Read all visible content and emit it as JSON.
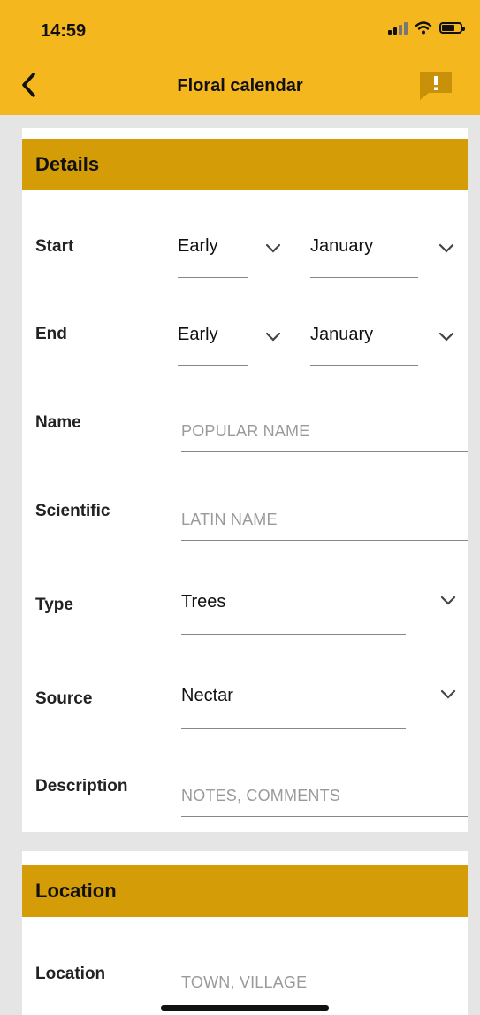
{
  "status": {
    "time": "14:59"
  },
  "header": {
    "title": "Floral calendar"
  },
  "details": {
    "section_title": "Details",
    "start": {
      "label": "Start",
      "period": "Early",
      "month": "January"
    },
    "end": {
      "label": "End",
      "period": "Early",
      "month": "January"
    },
    "name": {
      "label": "Name",
      "placeholder": "POPULAR NAME"
    },
    "scientific": {
      "label": "Scientific",
      "placeholder": "LATIN NAME"
    },
    "type": {
      "label": "Type",
      "value": "Trees"
    },
    "source": {
      "label": "Source",
      "value": "Nectar"
    },
    "description": {
      "label": "Description",
      "placeholder": "NOTES, COMMENTS"
    }
  },
  "location": {
    "section_title": "Location",
    "field": {
      "label": "Location",
      "placeholder": "TOWN, VILLAGE"
    }
  },
  "colors": {
    "header": "#f4b71e",
    "section": "#d49c07",
    "background": "#e5e5e5"
  }
}
